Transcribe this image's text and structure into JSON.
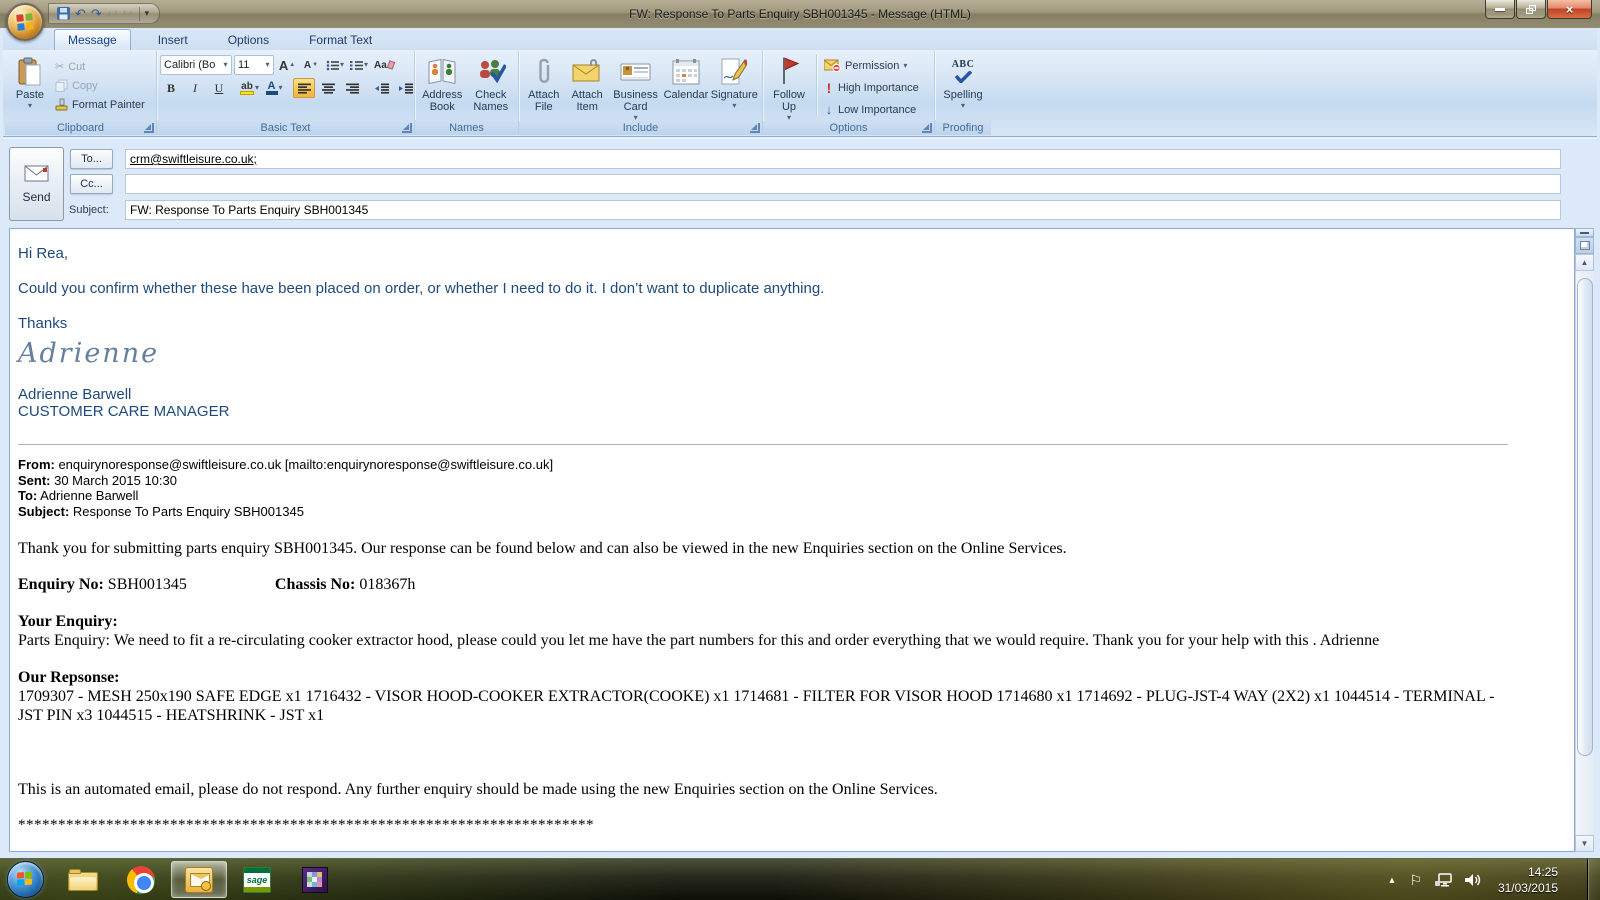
{
  "window": {
    "title": "FW: Response To Parts Enquiry SBH001345 - Message (HTML)"
  },
  "tabs": [
    {
      "label": "Message"
    },
    {
      "label": "Insert"
    },
    {
      "label": "Options"
    },
    {
      "label": "Format Text"
    }
  ],
  "ribbon": {
    "clipboard": {
      "label": "Clipboard",
      "paste": "Paste",
      "cut": "Cut",
      "copy": "Copy",
      "format_painter": "Format Painter"
    },
    "basic_text": {
      "label": "Basic Text",
      "font_name": "Calibri (Bo",
      "font_size": "11"
    },
    "names": {
      "label": "Names",
      "address_book": "Address Book",
      "check_names": "Check Names"
    },
    "include": {
      "label": "Include",
      "attach_file": "Attach File",
      "attach_item": "Attach Item",
      "business_card": "Business Card",
      "calendar": "Calendar",
      "signature": "Signature"
    },
    "options": {
      "label": "Options",
      "follow_up": "Follow Up",
      "permission": "Permission",
      "high_importance": "High Importance",
      "low_importance": "Low Importance"
    },
    "proofing": {
      "label": "Proofing",
      "spelling": "Spelling"
    }
  },
  "envelope": {
    "send_label": "Send",
    "to_button": "To...",
    "cc_button": "Cc...",
    "subject_label": "Subject:",
    "to_value": "crm@swiftleisure.co.uk;",
    "cc_value": "",
    "subject_value": "FW: Response To Parts Enquiry SBH001345"
  },
  "message": {
    "greeting": "Hi Rea,",
    "para1": "Could you confirm whether these have been placed on order, or whether I need to do it.  I don’t want to duplicate anything.",
    "thanks": "Thanks",
    "signature_script": "Adrienne",
    "signature_name": "Adrienne Barwell",
    "signature_role": "CUSTOMER CARE MANAGER",
    "quoted": {
      "from_label": "From:",
      "from_value": " enquirynoresponse@swiftleisure.co.uk [mailto:enquirynoresponse@swiftleisure.co.uk]",
      "sent_label": "Sent:",
      "sent_value": " 30 March 2015 10:30",
      "to_label": "To:",
      "to_value": " Adrienne Barwell",
      "subject_label": "Subject:",
      "subject_value": " Response To Parts Enquiry SBH001345"
    },
    "intro": "Thank you for submitting parts enquiry SBH001345. Our response can be found below and can also be viewed in the new Enquiries section on the Online Services.",
    "enquiry_no_label": "Enquiry No:",
    "enquiry_no_value": " SBH001345",
    "chassis_no_label": "Chassis No:",
    "chassis_no_value": " 018367h",
    "your_enquiry_label": "Your Enquiry:",
    "your_enquiry_text": "Parts Enquiry: We need to fit a re-circulating cooker extractor hood, please could you let me have the part numbers for this and order everything that we would require. Thank you for your help with this . Adrienne",
    "our_response_label": "Our Repsonse:",
    "our_response_text": "1709307 - MESH 250x190 SAFE EDGE x1 1716432 - VISOR HOOD-COOKER EXTRACTOR(COOKE) x1 1714681 - FILTER FOR VISOR HOOD 1714680 x1 1714692 - PLUG-JST-4 WAY (2X2) x1 1044514 - TERMINAL - JST PIN x3 1044515 - HEATSHRINK - JST x1",
    "automated_note": "This is an automated email, please do not respond. Any further enquiry should be made using the new Enquiries section on the Online Services.",
    "divider_asterisks": "************************************************************************"
  },
  "taskbar": {
    "sage_label": "sage",
    "time": "14:25",
    "date": "31/03/2015"
  },
  "icons": {
    "dropdown": "▾",
    "scissors": "✂",
    "undo": "↶",
    "redo": "↷",
    "nav_back": "↩",
    "nav_forward": "↪",
    "qat_more": "▾",
    "bold": "B",
    "italic": "I",
    "underline": "U",
    "letter_a": "A",
    "grow_tri": "▲",
    "shrink_tri": "▼",
    "highlight_ab": "ab",
    "clear_format": "Aa",
    "high_importance": "!",
    "low_importance": "↓",
    "abc": "ABC",
    "close": "×",
    "scroll_up": "▲",
    "scroll_down": "▼",
    "tray_hidden": "▲",
    "tray_flag": "⚐"
  }
}
